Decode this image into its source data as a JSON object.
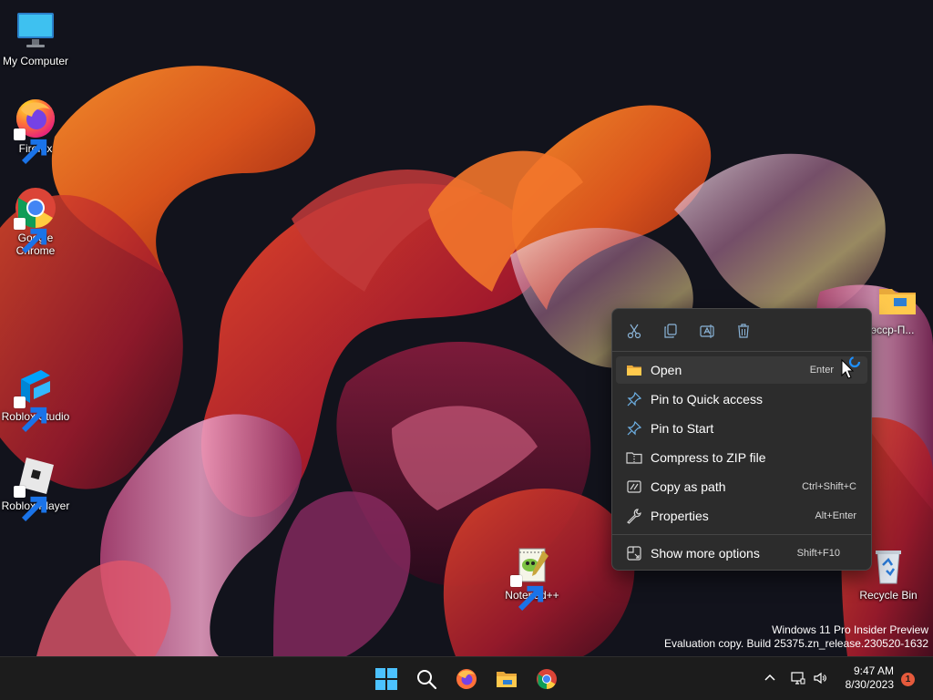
{
  "desktop_icons": [
    {
      "label": "My Computer",
      "icon": "monitor-icon"
    },
    {
      "label": "Firefox",
      "icon": "firefox-icon"
    },
    {
      "label": "Google Chrome",
      "icon": "chrome-icon"
    },
    {
      "label": "Roblox Studio",
      "icon": "roblox-studio-icon"
    },
    {
      "label": "Roblox Player",
      "icon": "roblox-player-icon"
    },
    {
      "label": "Notepad++",
      "icon": "notepad-plus-plus-icon"
    },
    {
      "label": "Recycle Bin",
      "icon": "recycle-bin-icon"
    },
    {
      "label": "эсср-П...",
      "icon": "folder-icon"
    }
  ],
  "context_menu": {
    "toolbar": [
      {
        "name": "cut",
        "icon": "scissors-icon"
      },
      {
        "name": "copy",
        "icon": "copy-icon"
      },
      {
        "name": "rename",
        "icon": "rename-icon"
      },
      {
        "name": "delete",
        "icon": "trash-icon"
      }
    ],
    "items": [
      {
        "label": "Open",
        "shortcut": "Enter",
        "icon": "folder-icon"
      },
      {
        "label": "Pin to Quick access",
        "shortcut": "",
        "icon": "pin-icon"
      },
      {
        "label": "Pin to Start",
        "shortcut": "",
        "icon": "pin-icon"
      },
      {
        "label": "Compress to ZIP file",
        "shortcut": "",
        "icon": "zip-icon"
      },
      {
        "label": "Copy as path",
        "shortcut": "Ctrl+Shift+C",
        "icon": "path-icon"
      },
      {
        "label": "Properties",
        "shortcut": "Alt+Enter",
        "icon": "wrench-icon"
      },
      {
        "label": "Show more options",
        "shortcut": "Shift+F10",
        "icon": "more-options-icon"
      }
    ]
  },
  "watermark": {
    "line1": "Windows 11 Pro Insider Preview",
    "line2": "Evaluation copy. Build 25375.zn_release.230520-1632"
  },
  "taskbar": {
    "apps": [
      "start-icon",
      "search-icon",
      "firefox-icon",
      "file-explorer-icon",
      "chrome-icon"
    ],
    "tray": [
      "chevron-up-icon",
      "network-icon",
      "volume-icon"
    ],
    "time": "9:47 AM",
    "date": "8/30/2023",
    "notification_count": "1"
  },
  "colors": {
    "menu_bg": "#2c2c2c",
    "menu_hover": "#383838",
    "taskbar_bg": "#1c1c1c",
    "accent": "#4cc2ff",
    "badge": "#e55a3c"
  }
}
